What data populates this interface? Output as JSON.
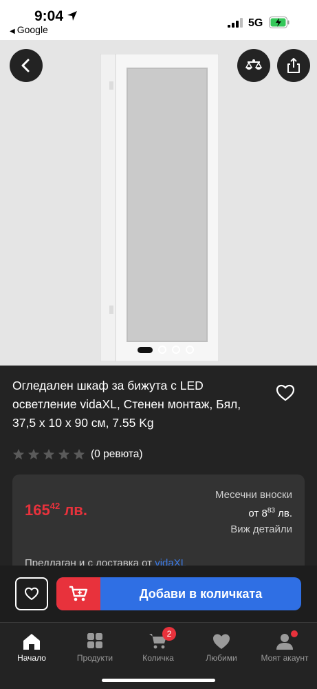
{
  "status_bar": {
    "time": "9:04",
    "back_app": "Google",
    "network": "5G"
  },
  "hero": {
    "image_alt": "mirrored jewellery cabinet",
    "pages": 4,
    "active_page": 1
  },
  "product": {
    "title": "Огледален шкаф за бижута с LED осветление vidaXL, Стенен монтаж, Бял, 37,5 x 10 x 90 см, 7.55 Kg",
    "rating": 0,
    "max_rating": 5,
    "reviews": "(0 ревюта)"
  },
  "price": {
    "whole": "165",
    "cents": "42",
    "currency": "лв.",
    "monthly_label": "Месечни вноски",
    "monthly_prefix": "от 8",
    "monthly_cents": "83",
    "monthly_currency": "лв.",
    "details_link": "Виж детайли",
    "seller_prefix": "Предлаган и с доставка от ",
    "seller_brand": "vidaXL"
  },
  "cart_bar": {
    "add_label": "Добави в количката"
  },
  "nav": {
    "items": [
      {
        "label": "Начало",
        "icon": "home-icon"
      },
      {
        "label": "Продукти",
        "icon": "grid-icon"
      },
      {
        "label": "Количка",
        "icon": "cart-icon"
      },
      {
        "label": "Любими",
        "icon": "heart-icon"
      },
      {
        "label": "Моят акаунт",
        "icon": "user-icon"
      }
    ],
    "cart_badge": "2"
  },
  "colors": {
    "accent_red": "#e8323c",
    "accent_blue": "#2f6fe4",
    "background": "#232323",
    "card": "#333333"
  }
}
